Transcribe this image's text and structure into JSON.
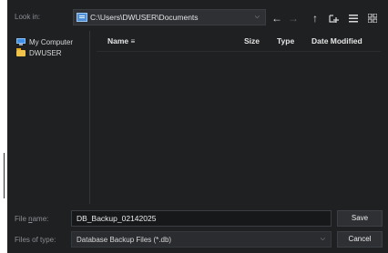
{
  "look_in": {
    "label": "Look in:",
    "path": "C:\\Users\\DWUSER\\Documents"
  },
  "toolbar": {
    "back_icon": "arrow-left-icon",
    "forward_icon": "arrow-right-icon",
    "up_icon": "arrow-up-icon",
    "new_folder_icon": "new-folder-icon",
    "list_view_icon": "list-view-icon",
    "detail_view_icon": "detail-view-icon"
  },
  "sidebar": {
    "items": [
      {
        "label": "My Computer",
        "icon": "computer-icon"
      },
      {
        "label": "DWUSER",
        "icon": "folder-icon"
      }
    ]
  },
  "file_list": {
    "columns": [
      "Name",
      "Size",
      "Type",
      "Date Modified"
    ],
    "sort_indicator": "≡"
  },
  "file_name": {
    "label_prefix": "File ",
    "label_mnemonic": "n",
    "label_suffix": "ame:",
    "value": "DB_Backup_02142025"
  },
  "file_type": {
    "label": "Files of type:",
    "value": "Database Backup Files (*.db)"
  },
  "buttons": {
    "save": "Save",
    "cancel": "Cancel"
  },
  "colors": {
    "background": "#1f2022",
    "accent": "#3f8fe8"
  }
}
